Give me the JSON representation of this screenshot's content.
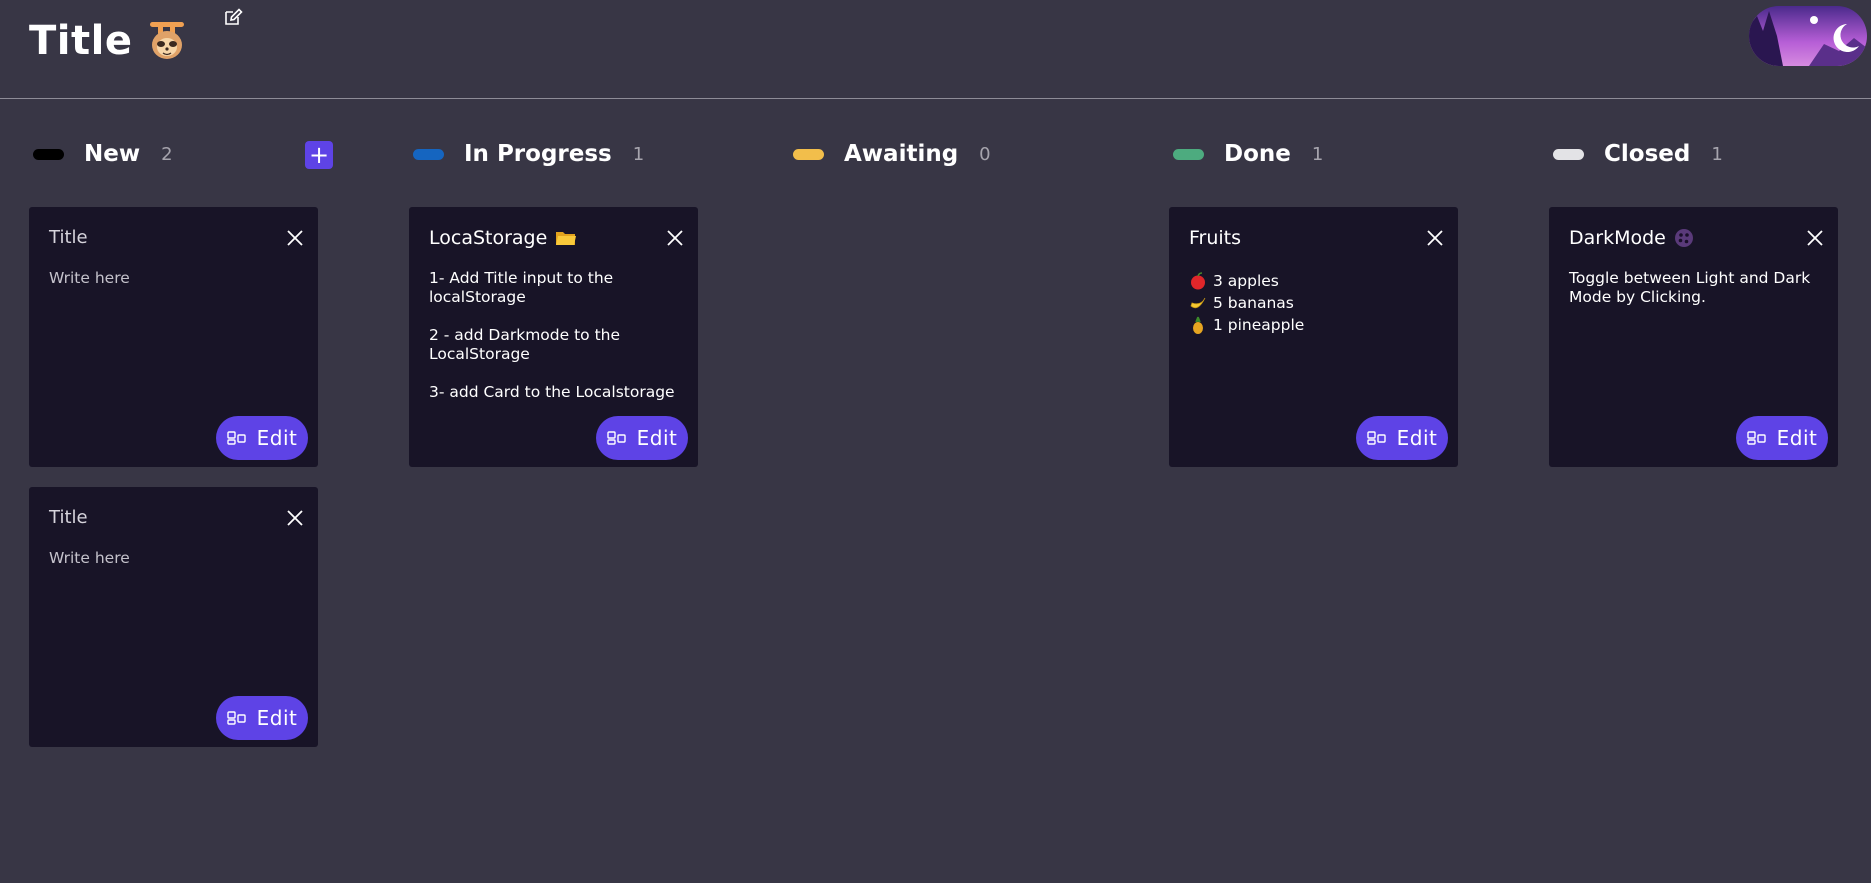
{
  "header": {
    "title": "Title"
  },
  "colors": {
    "background": "#383645",
    "card": "#181427",
    "accent": "#5e43e6",
    "new": "#000000",
    "in_progress": "#1565c0",
    "awaiting": "#f2be4b",
    "done": "#4dab7f",
    "closed": "#e3e3e6"
  },
  "columns": [
    {
      "name": "New",
      "count": "2",
      "add_label": "+"
    },
    {
      "name": "In Progress",
      "count": "1"
    },
    {
      "name": "Awaiting",
      "count": "0"
    },
    {
      "name": "Done",
      "count": "1"
    },
    {
      "name": "Closed",
      "count": "1"
    }
  ],
  "edit_label": "Edit",
  "cards": {
    "new_1": {
      "title": "Title",
      "body": "Write here"
    },
    "new_2": {
      "title": "Title",
      "body": "Write here"
    },
    "progress_1": {
      "title": "LocaStorage",
      "title_icon": "folder-icon",
      "lines": [
        "1- Add Title input to the localStorage",
        "2 - add Darkmode to the LocalStorage",
        "3- add Card  to the Localstorage"
      ]
    },
    "done_1": {
      "title": "Fruits",
      "items": [
        {
          "icon": "apple-icon",
          "text": "3 apples"
        },
        {
          "icon": "banana-icon",
          "text": "5 bananas"
        },
        {
          "icon": "pineapple-icon",
          "text": "1 pineapple"
        }
      ]
    },
    "closed_1": {
      "title": "DarkMode",
      "title_icon": "palette-icon",
      "body": "Toggle between Light and Dark Mode  by Clicking."
    }
  }
}
